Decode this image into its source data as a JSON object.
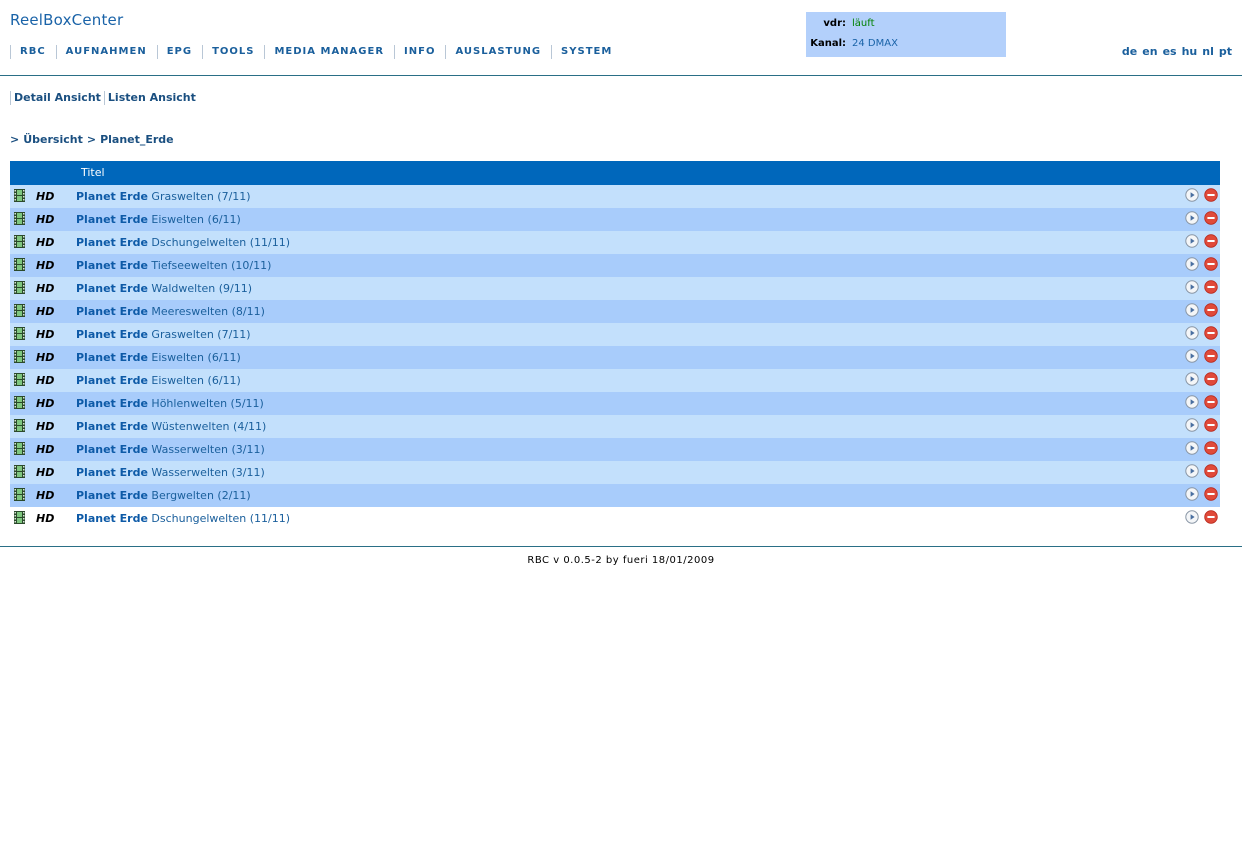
{
  "brand": "ReelBoxCenter",
  "nav": [
    "RBC",
    "AUFNAHMEN",
    "EPG",
    "TOOLS",
    "MEDIA MANAGER",
    "INFO",
    "AUSLASTUNG",
    "SYSTEM"
  ],
  "status": {
    "vdr_label": "vdr:",
    "vdr_value": "läuft",
    "kanal_label": "Kanal:",
    "kanal_value": "24 DMAX",
    "vdr_color": "#008000",
    "kanal_color": "#1a63a8"
  },
  "languages": [
    "de",
    "en",
    "es",
    "hu",
    "nl",
    "pt"
  ],
  "views": [
    "Detail Ansicht",
    "Listen Ansicht"
  ],
  "breadcrumb": {
    "sep1": ">",
    "overview": "Übersicht",
    "sep2": ">",
    "current": "Planet_Erde"
  },
  "table": {
    "header_title": "Titel",
    "quality": "HD",
    "series": "Planet Erde",
    "rows": [
      "Graswelten (7/11)",
      "Eiswelten (6/11)",
      "Dschungelwelten (11/11)",
      "Tiefseewelten (10/11)",
      "Waldwelten (9/11)",
      "Meereswelten (8/11)",
      "Graswelten (7/11)",
      "Eiswelten (6/11)",
      "Eiswelten (6/11)",
      "Höhlenwelten (5/11)",
      "Wüstenwelten (4/11)",
      "Wasserwelten (3/11)",
      "Wasserwelten (3/11)",
      "Bergwelten (2/11)",
      "Dschungelwelten (11/11)"
    ],
    "icons": {
      "row": "film-icon",
      "play": "play-icon",
      "delete": "delete-icon"
    }
  },
  "footer": "RBC v 0.0.5-2 by fueri 18/01/2009",
  "colors": {
    "header_bg": "#0067bb",
    "row_light": "#c3e0fc",
    "row_dark": "#a8ccfb",
    "status_bg": "#b3d0fb",
    "link": "#1a5f9c"
  }
}
